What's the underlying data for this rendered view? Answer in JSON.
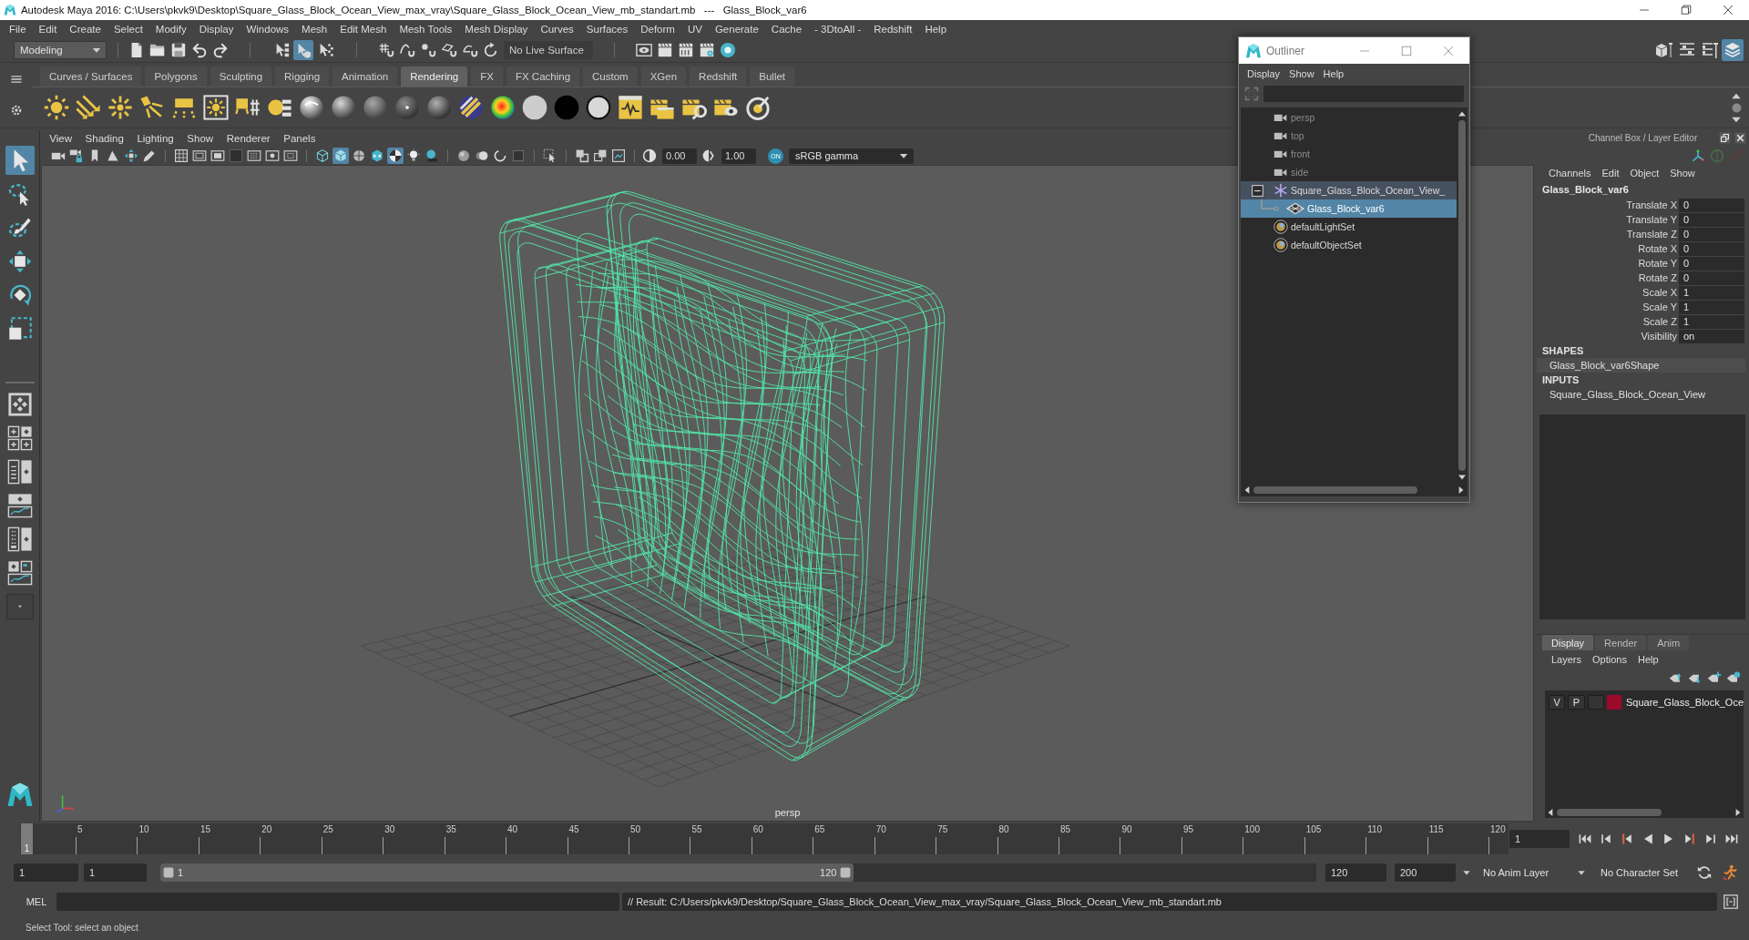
{
  "window": {
    "title": "Autodesk Maya 2016: C:\\Users\\pkvk9\\Desktop\\Square_Glass_Block_Ocean_View_max_vray\\Square_Glass_Block_Ocean_View_mb_standart.mb   ---   Glass_Block_var6"
  },
  "menu_bar": [
    "File",
    "Edit",
    "Create",
    "Select",
    "Modify",
    "Display",
    "Windows",
    "Mesh",
    "Edit Mesh",
    "Mesh Tools",
    "Mesh Display",
    "Curves",
    "Surfaces",
    "Deform",
    "UV",
    "Generate",
    "Cache",
    "- 3DtoAll -",
    "Redshift",
    "Help"
  ],
  "status_line": {
    "workspace": "Modeling",
    "select_modes": [
      {
        "selected": false
      },
      {
        "selected": true
      },
      {
        "selected": false
      }
    ],
    "live_surface": "No Live Surface",
    "panel_toggles": [
      {
        "selected": false
      },
      {
        "selected": false
      },
      {
        "selected": false
      },
      {
        "selected": true
      }
    ]
  },
  "shelf": {
    "tabs": [
      {
        "label": "Curves / Surfaces",
        "selected": false
      },
      {
        "label": "Polygons",
        "selected": false
      },
      {
        "label": "Sculpting",
        "selected": false
      },
      {
        "label": "Rigging",
        "selected": false
      },
      {
        "label": "Animation",
        "selected": false
      },
      {
        "label": "Rendering",
        "selected": true
      },
      {
        "label": "FX",
        "selected": false
      },
      {
        "label": "FX Caching",
        "selected": false
      },
      {
        "label": "Custom",
        "selected": false
      },
      {
        "label": "XGen",
        "selected": false
      },
      {
        "label": "Redshift",
        "selected": false
      },
      {
        "label": "Bullet",
        "selected": false
      }
    ]
  },
  "toolbox": {
    "tools": [
      {
        "kind": "select",
        "selected": true
      },
      {
        "kind": "lasso",
        "selected": false
      },
      {
        "kind": "paint",
        "selected": false
      },
      {
        "kind": "move",
        "selected": false
      },
      {
        "kind": "rotate",
        "selected": false
      },
      {
        "kind": "scale",
        "selected": false
      }
    ]
  },
  "viewport": {
    "menu": [
      "View",
      "Shading",
      "Lighting",
      "Show",
      "Renderer",
      "Panels"
    ],
    "toggles": [
      {
        "selected": false
      },
      {
        "selected": false
      },
      {
        "selected": false
      },
      {
        "selected": false
      },
      {
        "selected": false
      },
      {
        "selected": false
      },
      {
        "selected": false
      },
      {
        "selected": false
      },
      {
        "selected": false
      },
      {
        "selected": false
      },
      {
        "selected": false
      },
      {
        "selected": false
      },
      {
        "selected": false
      },
      {
        "selected": false
      },
      {
        "selected": true
      },
      {
        "selected": false
      },
      {
        "selected": false
      },
      {
        "selected": true
      },
      {
        "selected": false
      },
      {
        "selected": false
      },
      {
        "selected": false
      },
      {
        "selected": false
      },
      {
        "selected": false
      },
      {
        "selected": false
      },
      {
        "selected": false
      },
      {
        "selected": false
      },
      {
        "selected": false
      },
      {
        "selected": false
      }
    ],
    "exposure": "0.00",
    "gamma": "1.00",
    "color_management": {
      "label": "ON",
      "on": true
    },
    "view_transform": "sRGB gamma",
    "camera_label": "persp"
  },
  "outliner": {
    "title": "Outliner",
    "menu": [
      "Display",
      "Show",
      "Help"
    ],
    "items": [
      {
        "label": "persp",
        "kind": "camera",
        "dimmed": true,
        "selected": false
      },
      {
        "label": "top",
        "kind": "camera",
        "dimmed": true,
        "selected": false
      },
      {
        "label": "front",
        "kind": "camera",
        "dimmed": true,
        "selected": false
      },
      {
        "label": "side",
        "kind": "camera",
        "dimmed": true,
        "selected": false
      },
      {
        "label": "Square_Glass_Block_Ocean_View_",
        "kind": "group",
        "dimmed": false,
        "selected": false,
        "expanded": true,
        "children": [
          {
            "label": "Glass_Block_var6",
            "kind": "mesh",
            "dimmed": false,
            "selected": true
          }
        ]
      },
      {
        "label": "defaultLightSet",
        "kind": "set",
        "dimmed": false,
        "selected": false
      },
      {
        "label": "defaultObjectSet",
        "kind": "set",
        "dimmed": false,
        "selected": false
      }
    ]
  },
  "channel_box": {
    "title": "Channel Box / Layer Editor",
    "menu": [
      "Channels",
      "Edit",
      "Object",
      "Show"
    ],
    "object": "Glass_Block_var6",
    "attributes": [
      {
        "label": "Translate X",
        "value": "0"
      },
      {
        "label": "Translate Y",
        "value": "0"
      },
      {
        "label": "Translate Z",
        "value": "0"
      },
      {
        "label": "Rotate X",
        "value": "0"
      },
      {
        "label": "Rotate Y",
        "value": "0"
      },
      {
        "label": "Rotate Z",
        "value": "0"
      },
      {
        "label": "Scale X",
        "value": "1"
      },
      {
        "label": "Scale Y",
        "value": "1"
      },
      {
        "label": "Scale Z",
        "value": "1"
      },
      {
        "label": "Visibility",
        "value": "on"
      }
    ],
    "shapes_heading": "SHAPES",
    "shapes": [
      "Glass_Block_var6Shape"
    ],
    "inputs_heading": "INPUTS",
    "inputs": [
      "Square_Glass_Block_Ocean_View"
    ]
  },
  "layer_editor": {
    "tabs": [
      {
        "label": "Display",
        "selected": true
      },
      {
        "label": "Render",
        "selected": false
      },
      {
        "label": "Anim",
        "selected": false
      }
    ],
    "menu": [
      "Layers",
      "Options",
      "Help"
    ],
    "layers": [
      {
        "visibility": "V",
        "playback": "P",
        "name": "Square_Glass_Block_Oce",
        "color": "#9b0a2a"
      }
    ]
  },
  "timeline": {
    "ticks": [
      "5",
      "10",
      "15",
      "20",
      "25",
      "30",
      "35",
      "40",
      "45",
      "50",
      "55",
      "60",
      "65",
      "70",
      "75",
      "80",
      "85",
      "90",
      "95",
      "100",
      "105",
      "110",
      "115",
      "120"
    ],
    "current_frame": "1",
    "level": 0,
    "frame_field": "1"
  },
  "range_slider": {
    "start": "1",
    "playback_start": "1",
    "start_label": "1",
    "end_label": "120",
    "level": 0.6,
    "playback_end": "120",
    "end": "200",
    "anim_layer": "No Anim Layer",
    "character_set": "No Character Set"
  },
  "command_line": {
    "language": "MEL",
    "result": "// Result: C:/Users/pkvk9/Desktop/Square_Glass_Block_Ocean_View_max_vray/Square_Glass_Block_Ocean_View_mb_standart.mb"
  },
  "help_line": "Select Tool: select an object"
}
